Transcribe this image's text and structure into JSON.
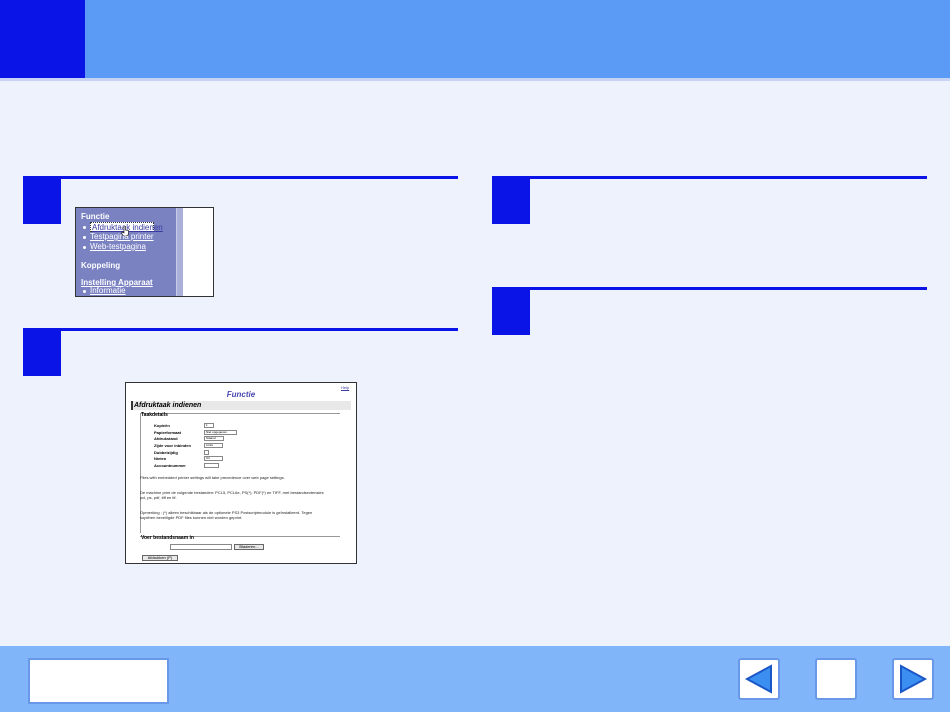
{
  "sidebar_shot": {
    "heading": "Functie",
    "items": [
      "Afdruktaak indienen",
      "Testpagina printer",
      "Web-testpagina"
    ],
    "section2": "Koppeling",
    "section3": "Instelling Apparaat",
    "section3_items": [
      "Informatie"
    ]
  },
  "form_shot": {
    "help": "Help",
    "title": "Functie",
    "band": "Afdruktaak indienen",
    "group": "Taakdetails",
    "fields": [
      {
        "label": "Kopieën",
        "value": "1"
      },
      {
        "label": "Papierformaat",
        "value": "Niet opgegeven"
      },
      {
        "label": "Afdrukstand",
        "value": "Staand"
      },
      {
        "label": "Zijde voor inbinden",
        "value": "Links"
      },
      {
        "label": "Dubbelzijdig",
        "value": ""
      },
      {
        "label": "Nieten",
        "value": "Uit"
      },
      {
        "label": "Accountnummer",
        "value": ""
      }
    ],
    "para1": "Files with embedded printer settings will take precedence over web page settings.",
    "para2": "De machine print de volgende bestanden: PCL5, PCL6e, PS(*), PDF(*) en TIFF, met bestandsextensies pcl, ps, pdf, tiff en tif.",
    "para3": "Opmerking : (*) alleen beschikbaar als de optionele PS3 Postscriptmodule is geïnstalleerd. Tegen kopiëren beveiligde PDF files kunnen niet worden geprint.",
    "file_label": "Voer bestandsnaam in",
    "browse": "Bladeren...",
    "submit": "Afdrukken (P)"
  },
  "icons": {
    "back": "left-arrow-icon",
    "home": "home-icon",
    "next": "right-arrow-icon"
  },
  "colors": {
    "accent": "#0a14e6",
    "header": "#5b9af5",
    "footer": "#80b5fa",
    "background": "#eef2fd"
  }
}
